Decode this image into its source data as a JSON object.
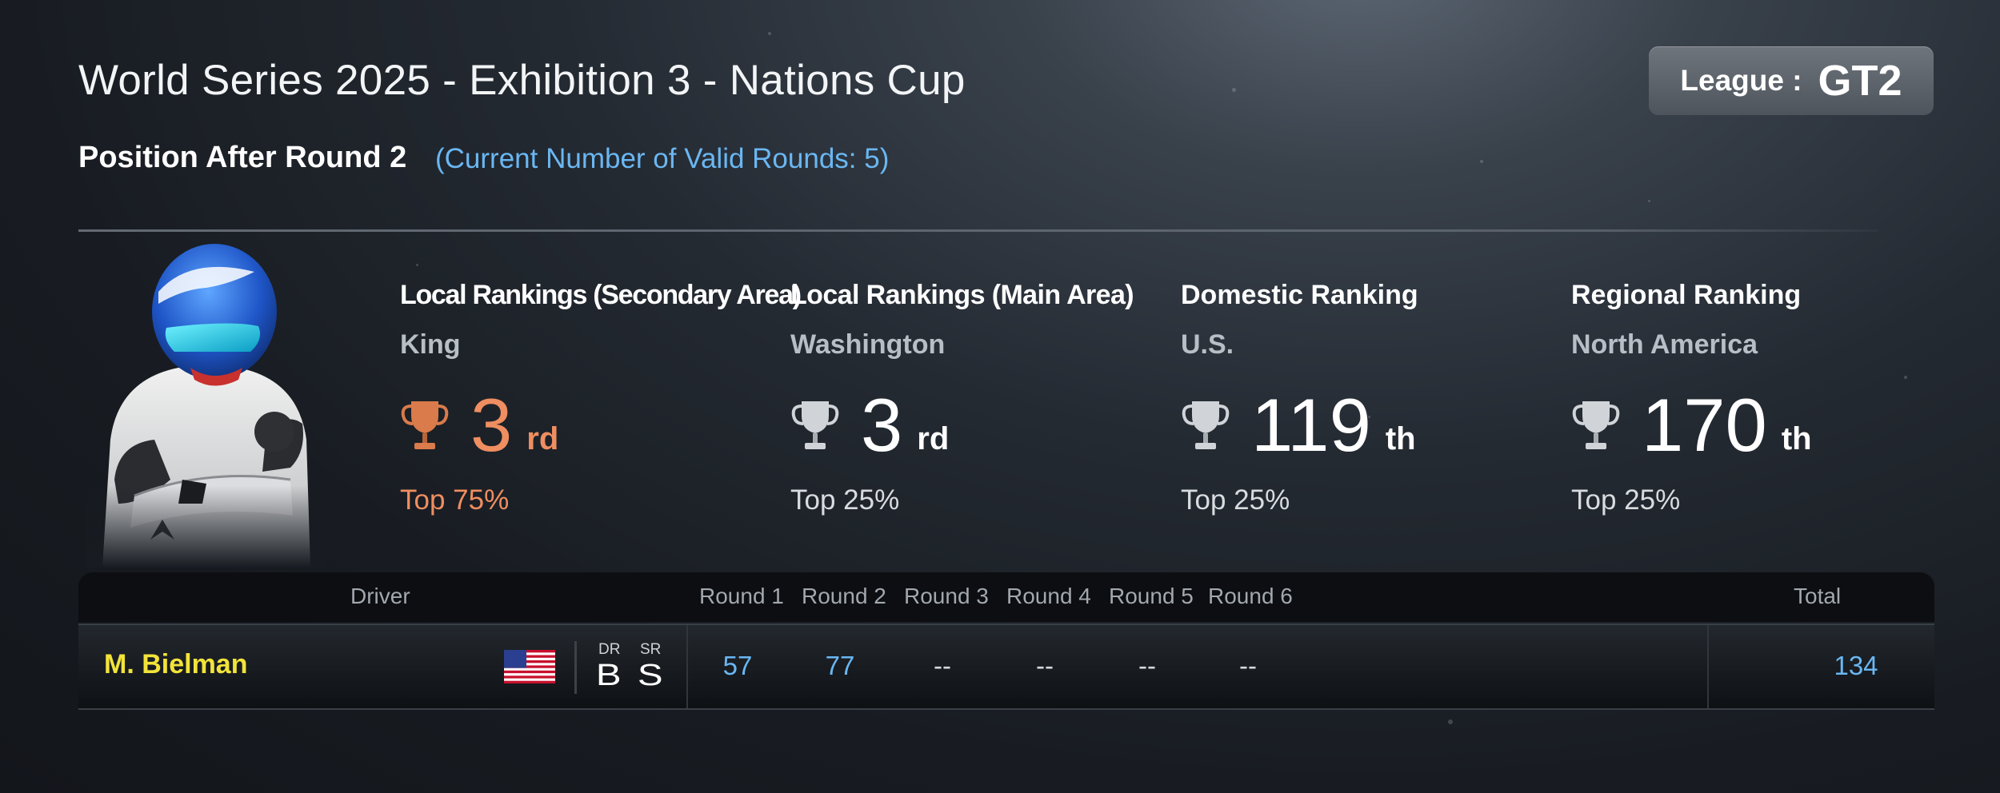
{
  "header": {
    "title": "World Series 2025 - Exhibition 3 - Nations Cup",
    "subtitle": "Position After Round 2",
    "subtitle_info": "(Current Number of Valid Rounds: 5)"
  },
  "league": {
    "label": "League :",
    "value": "GT2"
  },
  "rankings": [
    {
      "category": "Local Rankings (Secondary Area)",
      "area": "King",
      "place": "3",
      "suffix": "rd",
      "percent": "Top 75%",
      "trophy": "bronze"
    },
    {
      "category": "Local Rankings (Main Area)",
      "area": "Washington",
      "place": "3",
      "suffix": "rd",
      "percent": "Top 25%",
      "trophy": "silver"
    },
    {
      "category": "Domestic Ranking",
      "area": "U.S.",
      "place": "119",
      "suffix": "th",
      "percent": "Top 25%",
      "trophy": "silver"
    },
    {
      "category": "Regional Ranking",
      "area": "North America",
      "place": "170",
      "suffix": "th",
      "percent": "Top 25%",
      "trophy": "silver"
    }
  ],
  "table": {
    "headers": {
      "driver": "Driver",
      "rounds": [
        "Round 1",
        "Round 2",
        "Round 3",
        "Round 4",
        "Round 5",
        "Round 6"
      ],
      "total": "Total"
    },
    "row": {
      "driver": "M. Bielman",
      "flag": "us-flag-icon",
      "dr_label": "DR",
      "dr_value": "B",
      "sr_label": "SR",
      "sr_value": "S",
      "rounds": [
        "57",
        "77",
        "--",
        "--",
        "--",
        "--"
      ],
      "total": "134"
    }
  },
  "colors": {
    "background": "#1c2128",
    "accent_blue": "#6ab7f2",
    "driver_yellow": "#f2e33a",
    "bronze": "#ef8e60",
    "silver": "#d0d4d8"
  }
}
